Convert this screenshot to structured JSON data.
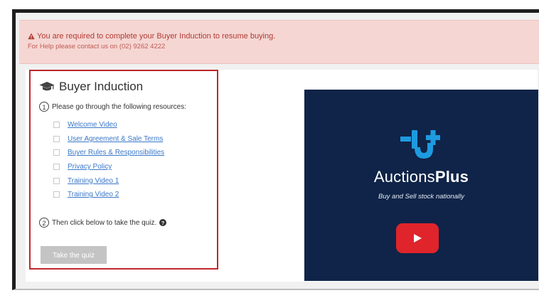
{
  "alert": {
    "message": "You are required to complete your Buyer Induction to resume buying.",
    "help": "For Help please contact us on (02) 9262 4222",
    "icon": "warning-triangle-icon",
    "color": "#b23a35",
    "background": "#f5d6d2"
  },
  "induction": {
    "title": "Buyer Induction",
    "title_icon": "graduation-cap-icon",
    "step1": {
      "number": "1",
      "text": "Please go through the following resources:"
    },
    "resources": [
      {
        "label": "Welcome Video"
      },
      {
        "label": "User Agreement & Sale Terms"
      },
      {
        "label": "Buyer Rules & Responsibilities"
      },
      {
        "label": "Privacy Policy"
      },
      {
        "label": "Training Video 1"
      },
      {
        "label": "Training Video 2"
      }
    ],
    "step2": {
      "number": "2",
      "text": "Then click below to take the quiz.",
      "icon": "help-circle-icon"
    },
    "quiz_button": "Take the quiz",
    "border_color": "#c0272d",
    "link_color": "#3a78c9"
  },
  "video": {
    "brand_light": "Auctions",
    "brand_bold": "Plus",
    "tagline": "Buy and Sell stock nationally",
    "logo_icon": "auctionsplus-logo-icon",
    "play_icon": "play-icon",
    "background": "#0f2448",
    "accent": "#1e9be0",
    "play_color": "#e0242b"
  }
}
